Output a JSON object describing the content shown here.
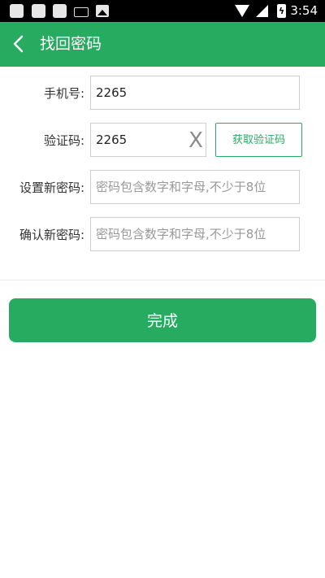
{
  "status_bar": {
    "time": "3:54",
    "battery_glyph": "ϟ",
    "icons": [
      "notification-icon",
      "notification-icon",
      "notification-icon",
      "keyboard-icon",
      "image-icon",
      "wifi-icon",
      "signal-icon",
      "battery-charging-icon"
    ]
  },
  "app_bar": {
    "title": "找回密码",
    "background": "#27ab60",
    "back_icon": "chevron-left-icon"
  },
  "form": {
    "phone": {
      "label": "手机号:",
      "value": "2265"
    },
    "code": {
      "label": "验证码:",
      "value": "2265",
      "clear_glyph": "X",
      "get_code_label": "获取验证码"
    },
    "new_password": {
      "label": "设置新密码:",
      "value": "",
      "placeholder": "密码包含数字和字母,不少于8位"
    },
    "confirm_password": {
      "label": "确认新密码:",
      "value": "",
      "placeholder": "密码包含数字和字母,不少于8位"
    }
  },
  "submit_label": "完成",
  "accent_color": "#27ab60"
}
